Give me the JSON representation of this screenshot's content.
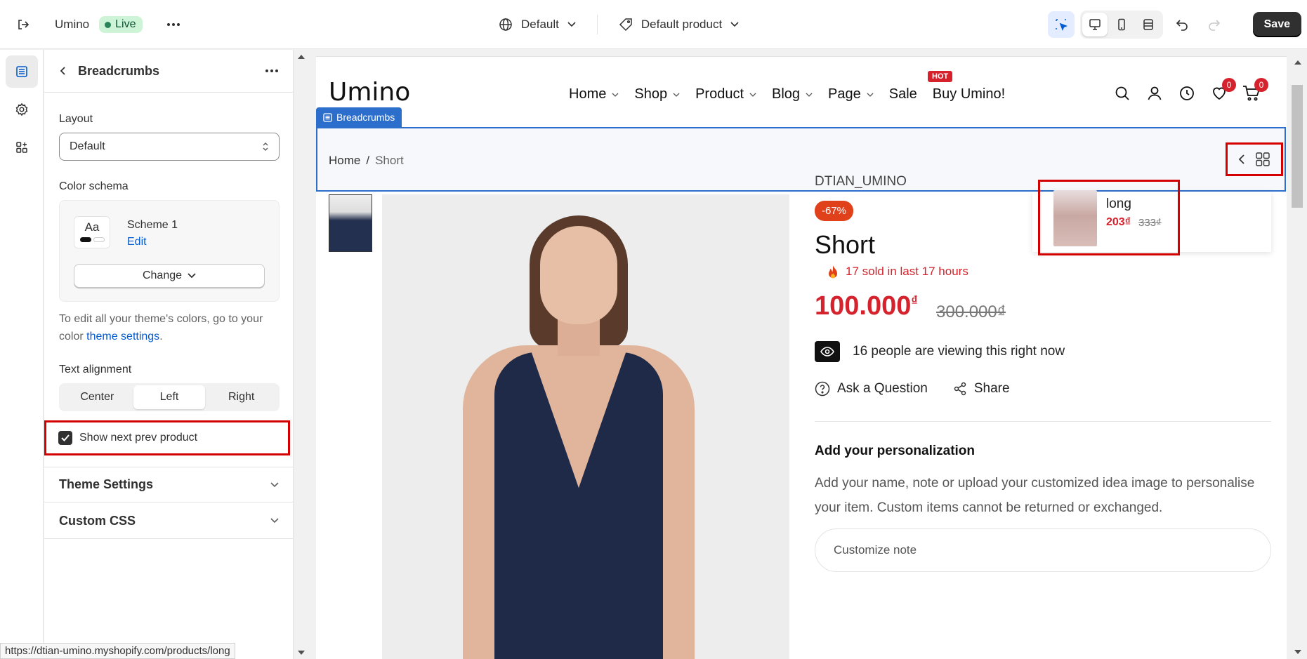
{
  "topbar": {
    "store_name": "Umino",
    "live_label": "Live",
    "theme_selector": "Default",
    "template_selector": "Default product",
    "save_label": "Save"
  },
  "panel": {
    "title": "Breadcrumbs",
    "layout_label": "Layout",
    "layout_value": "Default",
    "color_label": "Color schema",
    "scheme_swatch": "Aa",
    "scheme_name": "Scheme 1",
    "scheme_edit": "Edit",
    "change_label": "Change",
    "help_prefix": "To edit all your theme's colors, go to your color ",
    "help_link": "theme settings",
    "help_suffix": ".",
    "alignment_label": "Text alignment",
    "alignment_options": [
      "Center",
      "Left",
      "Right"
    ],
    "alignment_selected": "Left",
    "show_next_prev_label": "Show next prev product",
    "show_next_prev_checked": true,
    "theme_settings_label": "Theme Settings",
    "custom_css_label": "Custom CSS"
  },
  "statusbar": {
    "url": "https://dtian-umino.myshopify.com/products/long"
  },
  "site": {
    "logo": "Umino",
    "nav": [
      "Home",
      "Shop",
      "Product",
      "Blog",
      "Page",
      "Sale",
      "Buy Umino!"
    ],
    "hot_badge": "HOT",
    "wishlist_count": "0",
    "cart_count": "0"
  },
  "breadcrumb": {
    "tag": "Breadcrumbs",
    "home": "Home",
    "sep": "/",
    "current": "Short"
  },
  "popup": {
    "name": "long",
    "price": "203₫",
    "old_price": "333₫"
  },
  "product": {
    "vendor": "DTIAN_UMINO",
    "discount": "-67%",
    "title": "Short",
    "sold": "17 sold in last 17 hours",
    "price": "100.000",
    "currency": "₫",
    "old_price": "300.000₫",
    "viewing": "16 people are viewing this right now",
    "ask": "Ask a Question",
    "share": "Share",
    "personalization_title": "Add your personalization",
    "personalization_desc": "Add your name, note or upload your customized idea image to personalise your item. Custom items cannot be returned or exchanged.",
    "note_placeholder": "Customize note"
  },
  "colors": {
    "accent": "#2c6ecb",
    "highlight": "#d40000",
    "sale": "#d6222c",
    "live_bg": "#cdf4d6"
  }
}
